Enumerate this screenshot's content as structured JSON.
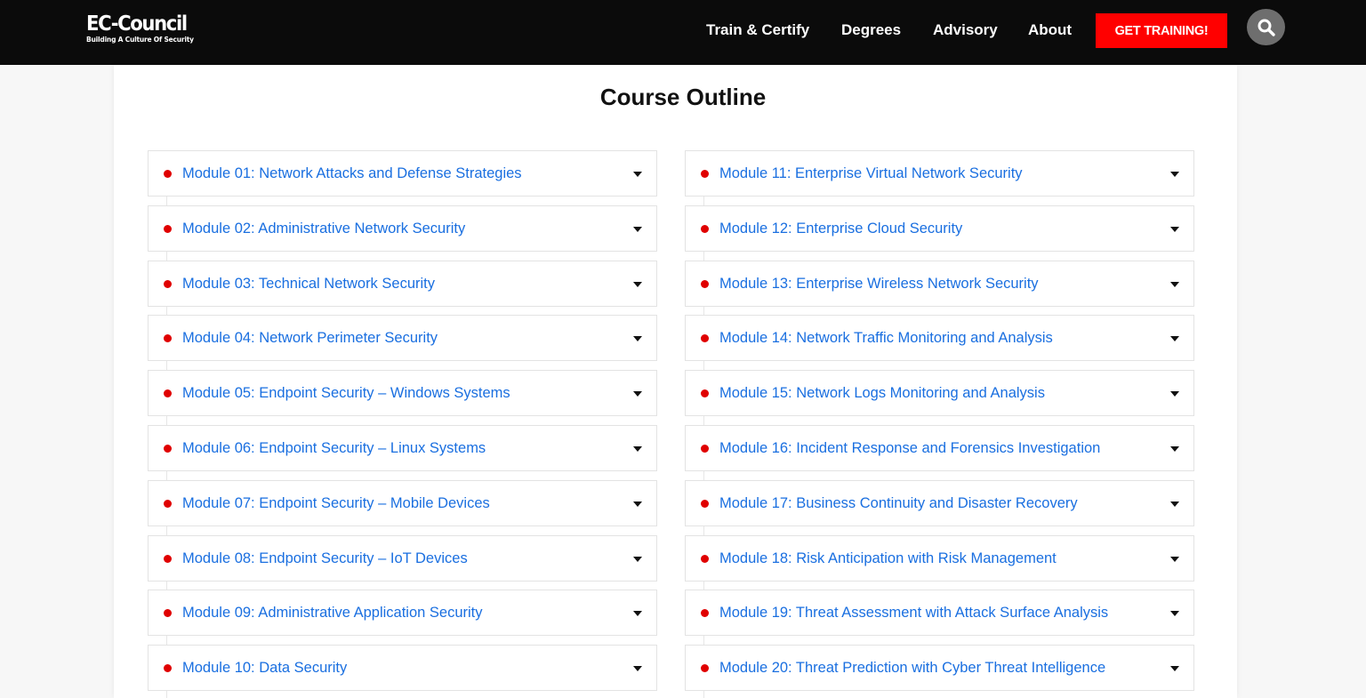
{
  "header": {
    "logo_name": "EC-Council",
    "logo_tagline": "Building A Culture Of Security",
    "nav": [
      "Train & Certify",
      "Degrees",
      "Advisory",
      "About"
    ],
    "cta_label": "GET TRAINING!",
    "search_icon": "search-icon"
  },
  "colors": {
    "header_bg": "#0b0b0b",
    "cta_bg": "#ff0000",
    "link": "#1a6fe0",
    "bullet": "#e00000"
  },
  "main": {
    "title": "Course Outline",
    "modules_left": [
      "Module 01: Network Attacks and Defense Strategies",
      "Module 02: Administrative Network Security",
      "Module 03: Technical Network Security",
      "Module 04: Network Perimeter Security",
      "Module 05: Endpoint Security – Windows Systems",
      "Module 06: Endpoint Security – Linux Systems",
      "Module 07: Endpoint Security – Mobile Devices",
      "Module 08: Endpoint Security – IoT Devices",
      "Module 09: Administrative Application Security",
      "Module 10: Data Security"
    ],
    "modules_right": [
      "Module 11: Enterprise Virtual Network Security",
      "Module 12: Enterprise Cloud Security",
      "Module 13: Enterprise Wireless Network Security",
      "Module 14: Network Traffic Monitoring and Analysis",
      "Module 15: Network Logs Monitoring and Analysis",
      "Module 16: Incident Response and Forensics Investigation",
      "Module 17: Business Continuity and Disaster Recovery",
      "Module 18: Risk Anticipation with Risk Management",
      "Module 19: Threat Assessment with Attack Surface Analysis",
      "Module 20: Threat Prediction with Cyber Threat Intelligence"
    ]
  }
}
